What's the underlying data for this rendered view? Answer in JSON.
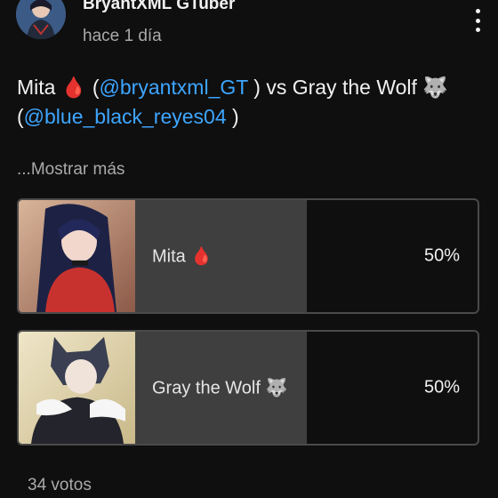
{
  "header": {
    "author": "BryantXML GTuber",
    "time": "hace 1 día"
  },
  "post": {
    "part1": "Mita 🩸 (",
    "mention1": "@bryantxml_GT",
    "part2": " ) vs Gray the Wolf 🐺 (",
    "mention2": "@blue_black_reyes04",
    "part3": " )"
  },
  "more_label": "...Mostrar más",
  "poll": {
    "options": [
      {
        "label": "Mita 🩸",
        "percent": "50%",
        "value": 50
      },
      {
        "label": "Gray the Wolf 🐺",
        "percent": "50%",
        "value": 50
      }
    ],
    "votes": "34 votos"
  },
  "colors": {
    "background": "#0f0f0f",
    "mention": "#3ea6ff",
    "bar_fill": "#3f3f3f"
  }
}
